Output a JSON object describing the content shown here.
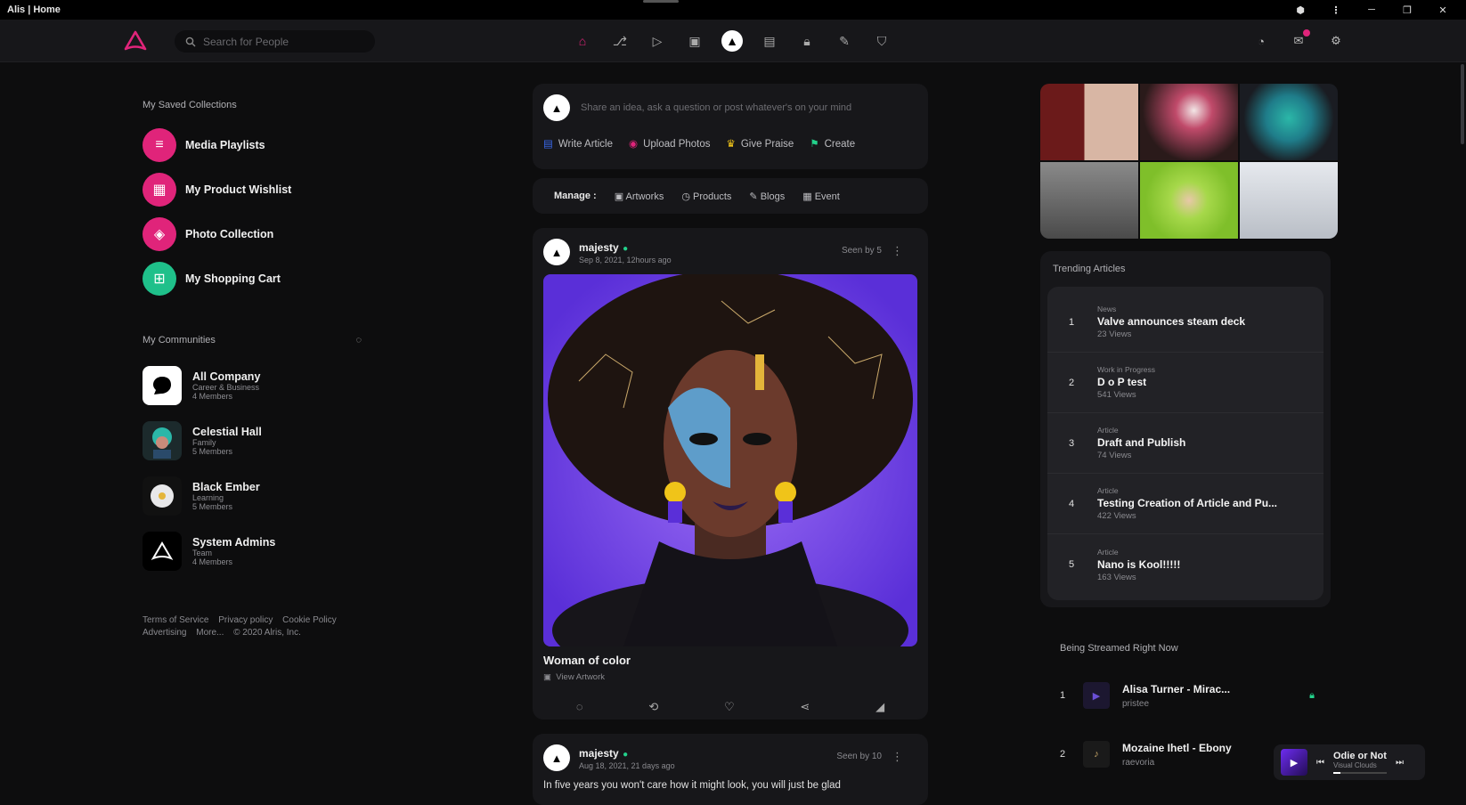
{
  "window": {
    "title": "Alis | Home"
  },
  "colors": {
    "accent": "#e0247a",
    "verified": "#23d18b",
    "background": "#0d0d0e",
    "card": "#17171a"
  },
  "topbar": {
    "logo_icon": "alis-logo-icon",
    "search": {
      "placeholder": "Search for People"
    },
    "nav_icons": [
      "home-icon",
      "share-tree-icon",
      "video-icon",
      "image-icon",
      "alis-home-icon",
      "article-icon",
      "lock-icon",
      "chat-icon",
      "shield-icon"
    ],
    "right_icons": [
      "lightbulb-icon",
      "messages-icon",
      "settings-icon"
    ]
  },
  "left": {
    "collections_title": "My Saved Collections",
    "collections": [
      {
        "label": "Media Playlists",
        "icon": "playlist-icon",
        "color": "#e0247a"
      },
      {
        "label": "My Product Wishlist",
        "icon": "wishlist-icon",
        "color": "#e0247a"
      },
      {
        "label": "Photo Collection",
        "icon": "photo-icon",
        "color": "#e0247a"
      },
      {
        "label": "My Shopping Cart",
        "icon": "cart-icon",
        "color": "#1fc08a"
      }
    ],
    "communities_title": "My Communities",
    "communities": [
      {
        "name": "All Company",
        "type": "Career & Business",
        "members": "4 Members"
      },
      {
        "name": "Celestial Hall",
        "type": "Family",
        "members": "5 Members"
      },
      {
        "name": "Black Ember",
        "type": "Learning",
        "members": "5 Members"
      },
      {
        "name": "System Admins",
        "type": "Team",
        "members": "4 Members"
      }
    ],
    "footer": {
      "terms": "Terms of Service",
      "privacy": "Privacy policy",
      "cookie": "Cookie Policy",
      "advertising": "Advertising",
      "more": "More...",
      "copyright": "© 2020 Alris, Inc."
    }
  },
  "center": {
    "composer": {
      "prompt": "Share an idea, ask a question or post whatever's on your mind",
      "actions": [
        {
          "label": "Write Article",
          "icon": "article-icon",
          "color": "#3b6cf5"
        },
        {
          "label": "Upload Photos",
          "icon": "photo-icon",
          "color": "#e0247a"
        },
        {
          "label": "Give Praise",
          "icon": "praise-icon",
          "color": "#f0c419"
        },
        {
          "label": "Create",
          "icon": "create-icon",
          "color": "#23d18b"
        }
      ]
    },
    "manage": {
      "label": "Manage :",
      "items": [
        {
          "label": "Artworks",
          "icon": "artwork-icon"
        },
        {
          "label": "Products",
          "icon": "product-icon"
        },
        {
          "label": "Blogs",
          "icon": "blog-icon"
        },
        {
          "label": "Event",
          "icon": "event-icon"
        }
      ]
    },
    "post1": {
      "user": "majesty",
      "date": "Sep 8, 2021, 12hours ago",
      "seen": "Seen by 5",
      "title": "Woman of color",
      "link": "View Artwork"
    },
    "post2": {
      "user": "majesty",
      "date": "Aug 18, 2021, 21 days ago",
      "seen": "Seen by 10",
      "text": "In five years you won't care how it might look, you will just be glad"
    }
  },
  "right": {
    "trending_title": "Trending Articles",
    "trending": [
      {
        "rank": "1",
        "category": "News",
        "title": "Valve announces steam deck",
        "views": "23 Views"
      },
      {
        "rank": "2",
        "category": "Work in Progress",
        "title": "D o P test",
        "views": "541 Views"
      },
      {
        "rank": "3",
        "category": "Article",
        "title": "Draft and Publish",
        "views": "74 Views"
      },
      {
        "rank": "4",
        "category": "Article",
        "title": "Testing Creation of Article and Pu...",
        "views": "422 Views"
      },
      {
        "rank": "5",
        "category": "Article",
        "title": "Nano is Kool!!!!!",
        "views": "163 Views"
      }
    ],
    "streamed_title": "Being Streamed Right Now",
    "streamed": [
      {
        "rank": "1",
        "title": "Alisa Turner - Mirac...",
        "artist": "pristee"
      },
      {
        "rank": "2",
        "title": "Mozaine Ihetl - Ebony",
        "artist": "raevoria"
      }
    ]
  },
  "player": {
    "title": "Odie or Not",
    "artist": "Visual Clouds"
  }
}
